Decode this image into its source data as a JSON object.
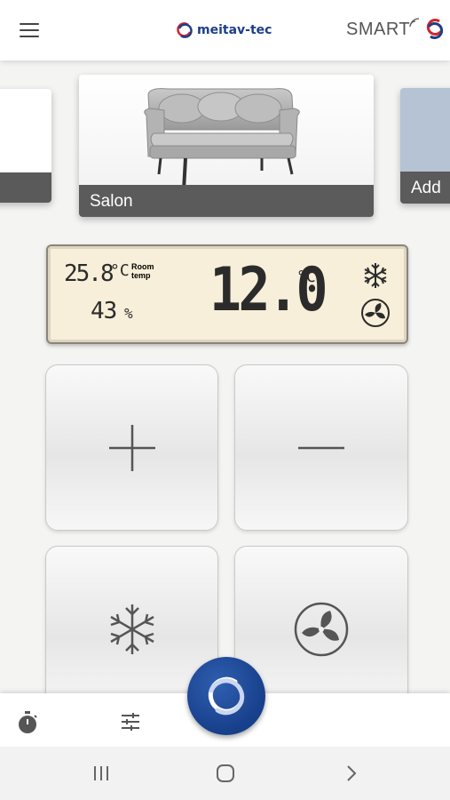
{
  "header": {
    "menu_icon": "hamburger-menu-icon",
    "logo_text": "meitav-tec",
    "smart_text": "SMART",
    "brand_color": "#1d3e8a",
    "accent_color": "#d2232a"
  },
  "rooms": {
    "items": [
      {
        "label": ""
      },
      {
        "label": "Salon"
      },
      {
        "label": "Add"
      }
    ],
    "selected": "Salon"
  },
  "display": {
    "room_temperature": "25.8",
    "room_temperature_unit": "°C",
    "room_temp_label_line1": "Room",
    "room_temp_label_line2": "temp",
    "humidity": "43",
    "humidity_unit": "%",
    "setpoint": "12.0",
    "setpoint_unit": "°C",
    "mode_icon": "snowflake-icon",
    "fan_icon": "fan-icon",
    "background_color": "#f7efd9"
  },
  "controls": {
    "increase_icon": "plus-icon",
    "decrease_icon": "minus-icon",
    "mode_icon": "snowflake-icon",
    "fan_icon": "fan-icon"
  },
  "bottom_bar": {
    "timer_icon": "stopwatch-icon",
    "settings_icon": "sliders-icon",
    "home_icon": "meitav-logo-icon"
  },
  "system_nav": {
    "recent_icon": "recent-apps-icon",
    "home_icon": "home-icon",
    "back_icon": "back-chevron-icon"
  }
}
